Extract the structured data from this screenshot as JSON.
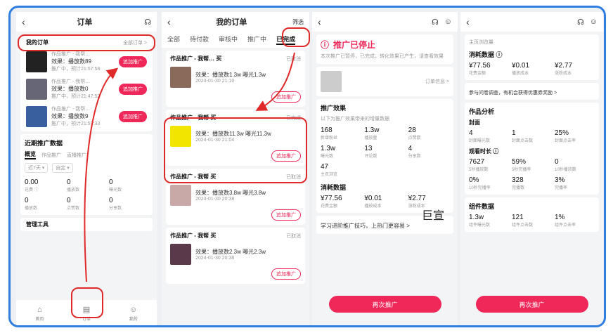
{
  "panel1": {
    "title": "订单",
    "my_orders_label": "我的订单",
    "all_orders_label": "全部订单 >",
    "orders": [
      {
        "name": "作品推广 - 我帮…",
        "effect": "效果：播放数89",
        "status": "推广中，预计21:57:58",
        "button": "追加推广",
        "color": "#222"
      },
      {
        "name": "作品推广 - 我帮…",
        "effect": "效果：播放数0",
        "status": "推广中，预计21:47:52",
        "button": "追加推广",
        "color": "#667"
      },
      {
        "name": "作品推广 - 我帮…",
        "effect": "效果：播放数9",
        "status": "推广中，预计21:57:33",
        "button": "追加推广",
        "color": "#3a5f9f"
      }
    ],
    "recent_title": "近期推广数据",
    "subtabs": [
      "概览",
      "作品推广",
      "直播推广"
    ],
    "filters": [
      "近7天 ▾",
      "自定 ▾"
    ],
    "stats": [
      {
        "value": "0.00",
        "label": "花费 ⓘ"
      },
      {
        "value": "0",
        "label": "播放数"
      },
      {
        "value": "0",
        "label": "曝光数"
      },
      {
        "value": "0",
        "label": "播放数"
      },
      {
        "value": "0",
        "label": "点赞数"
      },
      {
        "value": "0",
        "label": "分享数"
      }
    ],
    "tools_title": "管理工具",
    "nav": [
      {
        "label": "首页"
      },
      {
        "label": "订单"
      },
      {
        "label": "我的"
      }
    ]
  },
  "panel2": {
    "title": "我的订单",
    "filter": "筛选",
    "tabs": [
      "全部",
      "待付款",
      "审核中",
      "推广中",
      "已完成"
    ],
    "orders": [
      {
        "name": "作品推广 - 我帮…",
        "suffix": "买",
        "status": "已取消",
        "effect": "效果：播放数1.3w 曝光1.3w",
        "time": "2024-01-30 21:10",
        "button": "追加推广",
        "color": "#8a6a5a"
      },
      {
        "name": "作品推广 - 我帮",
        "suffix": "买",
        "status": "已完成",
        "effect": "效果：播放数11.3w 曝光11.3w",
        "time": "2024-01-30 21:04",
        "button": "追加推广",
        "color": "#f2e600"
      },
      {
        "name": "作品推广 - 我帮",
        "suffix": "买",
        "status": "已取消",
        "effect": "效果：播放数3.8w 曝光3.8w",
        "time": "2024-01-30 20:38",
        "button": "追加推广",
        "color": "#c9a8a8"
      },
      {
        "name": "作品推广 - 我帮",
        "suffix": "买",
        "status": "已取消",
        "effect": "效果：播放数2.3w 曝光2.3w",
        "time": "2024-01-30 20:38",
        "button": "追加推广",
        "color": "#5a3a4a"
      }
    ]
  },
  "panel3": {
    "stopped_title": "推广已停止",
    "stopped_sub": "本次推广已暂停，已完成，转化效果已产生，请查看效果",
    "order_info": "订单信息 >",
    "effects_title": "推广效果",
    "effects_sub": "以下为推广效果带来的增量数据",
    "effects": [
      {
        "value": "168",
        "label": "新增粉丝"
      },
      {
        "value": "1.3w",
        "label": "播放量"
      },
      {
        "value": "28",
        "label": "点赞数"
      },
      {
        "value": "1.3w",
        "label": "曝光数"
      },
      {
        "value": "13",
        "label": "评论数"
      },
      {
        "value": "4",
        "label": "分享数"
      },
      {
        "value": "47",
        "label": "主页浏览"
      }
    ],
    "cost_title": "消耗数据",
    "costs": [
      {
        "value": "¥77.56",
        "label": "花费金额"
      },
      {
        "value": "¥0.01",
        "label": "播放成本"
      },
      {
        "value": "¥2.77",
        "label": "涨粉成本"
      }
    ],
    "tip": "学习进阶推广技巧，上热门更容易 >",
    "cta": "再次推广"
  },
  "panel4": {
    "top_label": "主页浏览量",
    "cost_title": "消耗数据 ⓘ",
    "costs": [
      {
        "value": "¥77.56",
        "label": "花费金额"
      },
      {
        "value": "¥0.01",
        "label": "播放成本"
      },
      {
        "value": "¥2.77",
        "label": "涨粉成本"
      }
    ],
    "tip": "参与问卷调查，有机会获得优惠券奖励 >",
    "analysis_title": "作品分析",
    "cover_title": "封面",
    "cover": [
      {
        "value": "4",
        "label": "封面曝光数"
      },
      {
        "value": "1",
        "label": "封面点击数"
      },
      {
        "value": "25%",
        "label": "封面点击率"
      }
    ],
    "watch_title": "观看时长 ⓘ",
    "watch": [
      {
        "value": "7627",
        "label": "5秒播放数"
      },
      {
        "value": "59%",
        "label": "5秒完播率"
      },
      {
        "value": "0",
        "label": "10秒播放数"
      },
      {
        "value": "0%",
        "label": "10秒完播率"
      },
      {
        "value": "328",
        "label": "完播数"
      },
      {
        "value": "3%",
        "label": "完播率"
      }
    ],
    "component_title": "组件数据",
    "component": [
      {
        "value": "1.3w",
        "label": "组件曝光数"
      },
      {
        "value": "121",
        "label": "组件点击数"
      },
      {
        "value": "1%",
        "label": "组件点击率"
      }
    ],
    "cta": "再次推广"
  },
  "watermark": "巨宣",
  "colors": {
    "accent": "#f0285a",
    "frame": "#2f7fe3",
    "annotation": "#e02a2a"
  }
}
